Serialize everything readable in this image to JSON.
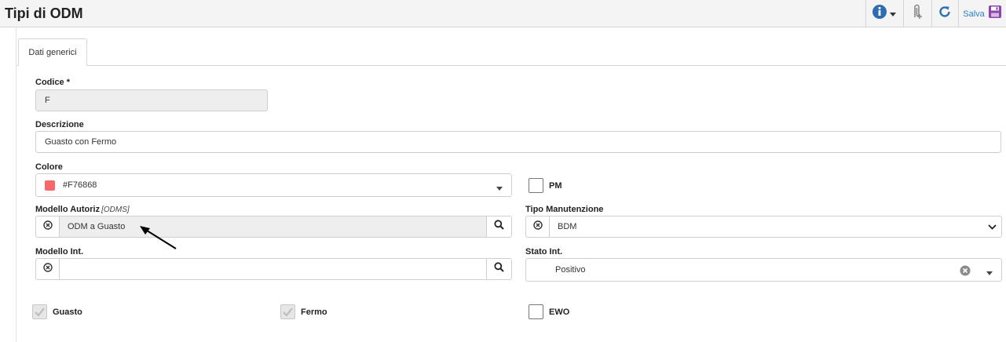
{
  "header": {
    "title": "Tipi di ODM",
    "save_label": "Salva",
    "icons": [
      "info-icon",
      "attachment-icon",
      "refresh-icon",
      "save-icon"
    ]
  },
  "tabs": [
    {
      "label": "Dati generici",
      "active": true
    }
  ],
  "form": {
    "codice": {
      "label": "Codice",
      "required_mark": "*",
      "value": "F"
    },
    "descrizione": {
      "label": "Descrizione",
      "value": "Guasto con Fermo"
    },
    "colore": {
      "label": "Colore",
      "value": "#F76868",
      "swatch": "#F76868"
    },
    "pm": {
      "label": "PM",
      "checked": false
    },
    "modello_autoriz": {
      "label": "Modello Autoriz",
      "hint": "[ODMS]",
      "value": "ODM a Guasto"
    },
    "tipo_manutenzione": {
      "label": "Tipo Manutenzione",
      "value": "BDM"
    },
    "modello_int": {
      "label": "Modello Int.",
      "value": ""
    },
    "stato_int": {
      "label": "Stato Int.",
      "value": "Positivo"
    },
    "guasto": {
      "label": "Guasto",
      "checked": true
    },
    "fermo": {
      "label": "Fermo",
      "checked": true
    },
    "ewo": {
      "label": "EWO",
      "checked": false
    }
  },
  "colors": {
    "accent": "#2E7EC8",
    "info": "#2E6DB4",
    "save": "#8E44AD",
    "input_border": "#CFCFCF",
    "readonly_bg": "#EEEEEE"
  }
}
